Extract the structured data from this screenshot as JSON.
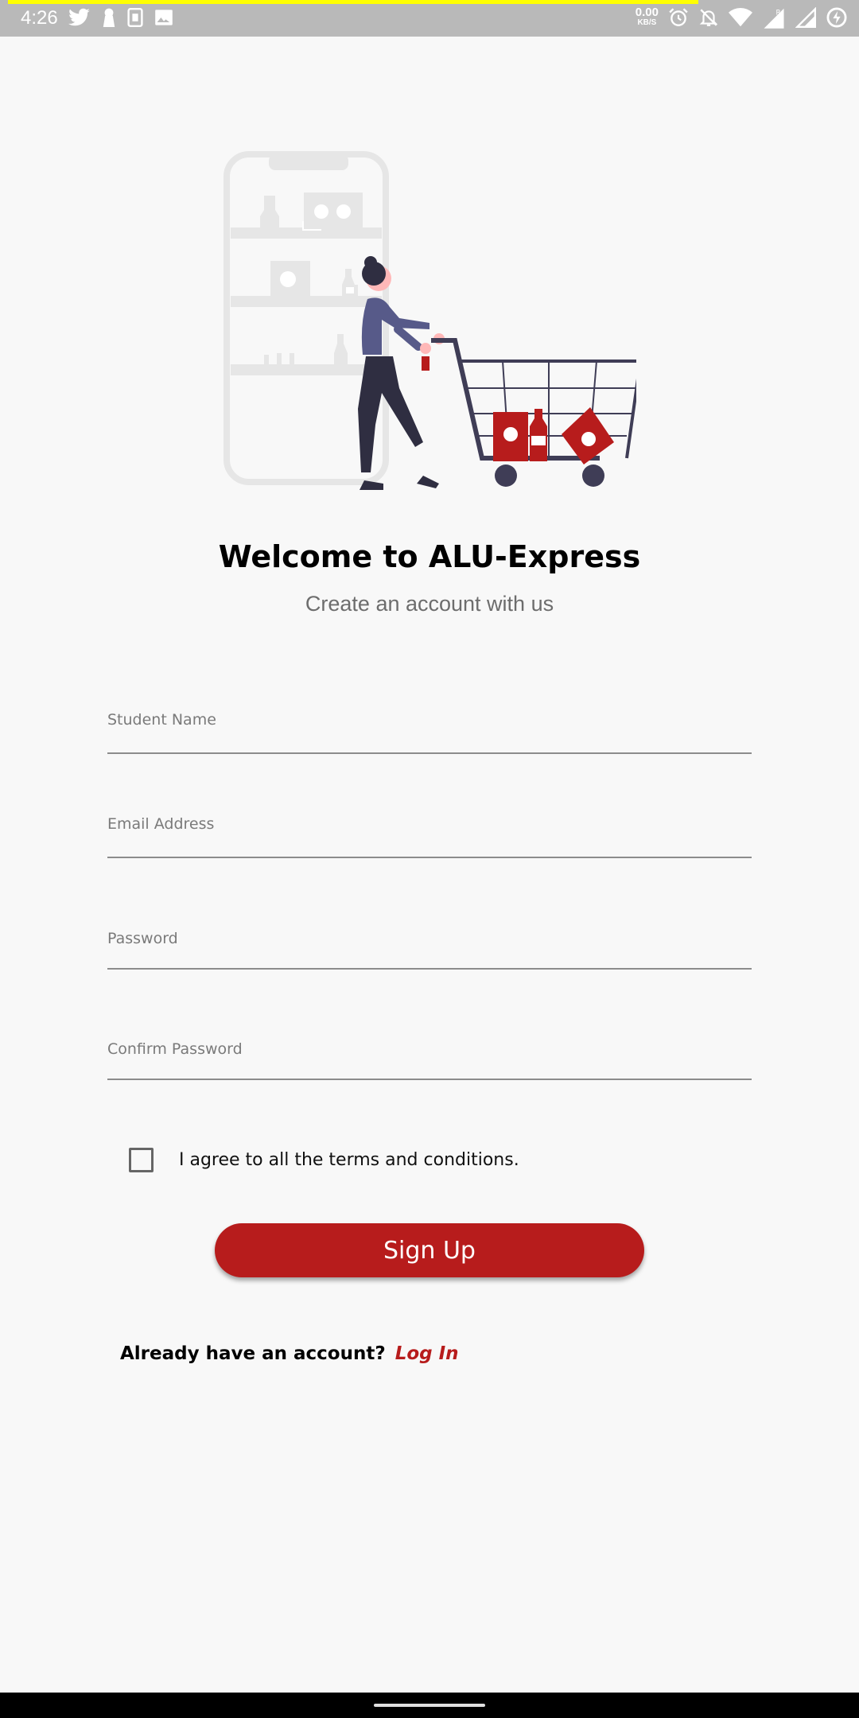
{
  "status_bar": {
    "time": "4:26",
    "net_speed_value": "0.00",
    "net_speed_unit": "KB/S",
    "left_icons": [
      "twitter-icon",
      "keyhole-icon",
      "sim-card-icon",
      "image-icon"
    ],
    "right_icons": [
      "alarm-icon",
      "notifications-off-icon",
      "wifi-icon",
      "signal-r-icon",
      "signal-icon",
      "battery-saver-icon"
    ]
  },
  "hero": {
    "icon": "shopping-cart-illustration"
  },
  "header": {
    "title": "Welcome to ALU-Express",
    "subtitle": "Create an account with us"
  },
  "form": {
    "student_name_label": "Student Name",
    "email_label": "Email Address",
    "password_label": "Password",
    "confirm_password_label": "Confirm Password",
    "terms_label": "I agree to all the terms and conditions.",
    "terms_checked": false,
    "signup_label": "Sign Up"
  },
  "footer": {
    "prompt": "Already have an account?",
    "login_label": "Log In"
  },
  "colors": {
    "accent": "#b71c1c",
    "status_bar": "#b9b9b9",
    "background": "#f8f8f8"
  }
}
